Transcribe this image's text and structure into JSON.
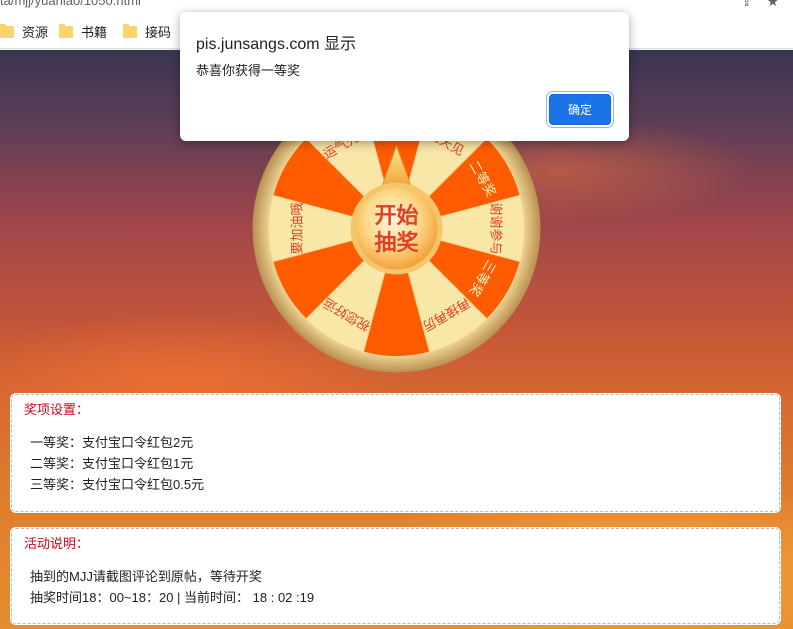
{
  "browser": {
    "url_fragment": "ta/mjj/yuanlao/1050.html",
    "bookmarks": [
      {
        "label": "资源"
      },
      {
        "label": "书籍"
      },
      {
        "label": "接码"
      }
    ]
  },
  "alert": {
    "title": "pis.junsangs.com 显示",
    "message": "恭喜你获得一等奖",
    "ok_label": "确定"
  },
  "wheel": {
    "start_label_line1": "开始",
    "start_label_line2": "抽奖",
    "slices": [
      {
        "label": "一等奖",
        "color": "#ff5b00"
      },
      {
        "label": "明天见",
        "color": "#f8e7a6"
      },
      {
        "label": "二等奖",
        "color": "#ff5b00"
      },
      {
        "label": "谢谢参与",
        "color": "#f8e7a6"
      },
      {
        "label": "三等奖",
        "color": "#ff5b00"
      },
      {
        "label": "再接再厉",
        "color": "#f8e7a6"
      },
      {
        "label": "",
        "color": "#ff5b00"
      },
      {
        "label": "祝您好运",
        "color": "#f8e7a6"
      },
      {
        "label": "",
        "color": "#ff5b00"
      },
      {
        "label": "要加油哦",
        "color": "#f8e7a6"
      },
      {
        "label": "",
        "color": "#ff5b00"
      },
      {
        "label": "运气先生",
        "color": "#f8e7a6"
      }
    ]
  },
  "prize_card": {
    "title": "奖项设置：",
    "lines": [
      "一等奖：支付宝口令红包2元",
      "二等奖：支付宝口令红包1元",
      "三等奖：支付宝口令红包0.5元"
    ]
  },
  "activity_card": {
    "title": "活动说明：",
    "lines": [
      "抽到的MJJ请截图评论到原帖，等待开奖",
      "抽奖时间18：00~18：20 | 当前时间： 18 : 02 :19"
    ]
  },
  "colors": {
    "accent_red": "#d0021b",
    "button_blue": "#1a73e8"
  }
}
